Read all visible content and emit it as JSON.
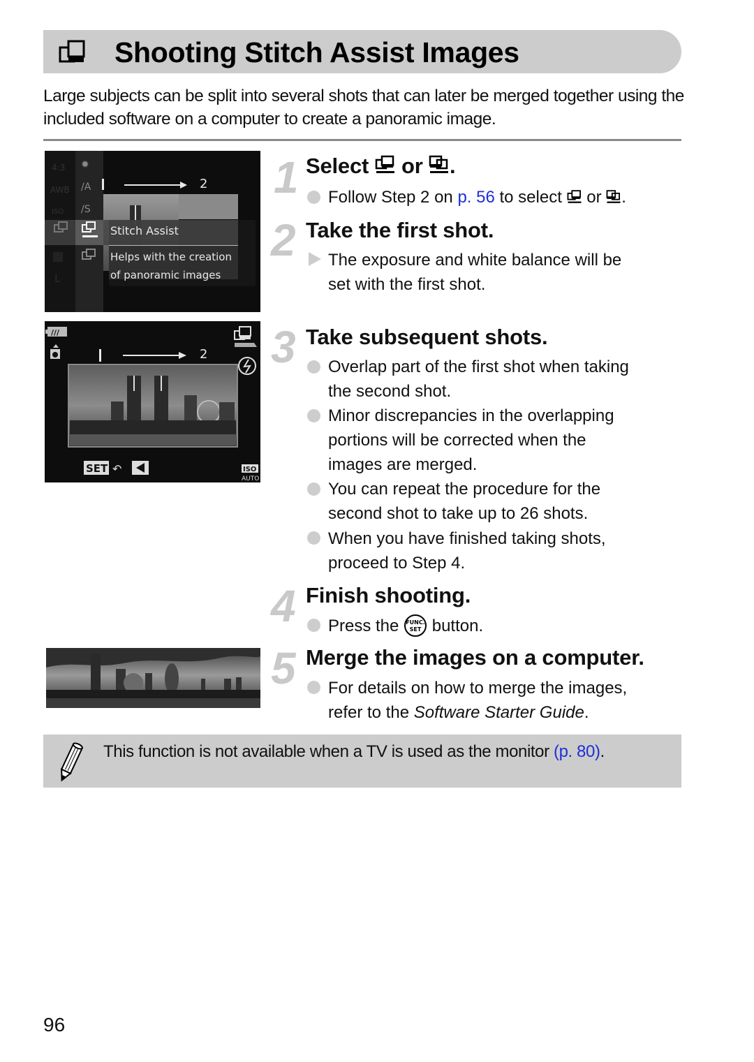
{
  "title": {
    "icon": "stitch-assist-icon",
    "text": "Shooting Stitch Assist Images"
  },
  "intro": "Large subjects can be split into several shots that can later be merged together using the included software on a computer to create a panoramic image.",
  "screen1": {
    "counter_from": "1",
    "counter_to": "2",
    "menu_item_title": "Stitch Assist",
    "menu_item_desc_line1": "Helps with the creation",
    "menu_item_desc_line2": "of panoramic images",
    "left_column_labels": [
      "4:3",
      "AWB",
      "ISO AUTO"
    ]
  },
  "screen2": {
    "counter_from": "1",
    "counter_to": "2",
    "set_label": "SET",
    "iso_top": "ISO",
    "iso_bottom": "AUTO"
  },
  "steps": [
    {
      "number": "1",
      "title_prefix": "Select",
      "title_mid": "or",
      "title_suffix": ".",
      "bullets": [
        {
          "type": "dot",
          "parts": {
            "a": "Follow Step 2 on ",
            "link": "p. 56",
            "b": " to select ",
            "c": " or ",
            "d": "."
          }
        }
      ]
    },
    {
      "number": "2",
      "title": "Take the first shot.",
      "bullets": [
        {
          "type": "result",
          "line1": "The exposure and white balance will be",
          "line2": "set with the first shot."
        }
      ]
    },
    {
      "number": "3",
      "title": "Take subsequent shots.",
      "bullets": [
        {
          "type": "dot",
          "line1": "Overlap part of the first shot when taking",
          "line2": "the second shot."
        },
        {
          "type": "dot",
          "line1": "Minor discrepancies in the overlapping",
          "line2": "portions will be corrected when the",
          "line3": "images are merged."
        },
        {
          "type": "dot",
          "line1": "You can repeat the procedure for the",
          "line2": "second shot to take up to 26 shots."
        },
        {
          "type": "dot",
          "line1": "When you have finished taking shots,",
          "line2": "proceed to Step 4."
        }
      ]
    },
    {
      "number": "4",
      "title": "Finish shooting.",
      "bullets": [
        {
          "type": "dot",
          "a": "Press the ",
          "button_top": "FUNC.",
          "button_bottom": "SET",
          "b": " button."
        }
      ]
    },
    {
      "number": "5",
      "title": "Merge the images on a computer.",
      "bullets": [
        {
          "type": "dot",
          "line1": "For details on how to merge the images,",
          "line2_a": "refer to the ",
          "line2_italic": "Software Starter Guide",
          "line2_b": "."
        }
      ]
    }
  ],
  "note": {
    "icon": "pencil-icon",
    "text": "This function is not available when a TV is used as the monitor ",
    "link": "(p. 80)",
    "end": "."
  },
  "page_number": "96",
  "colors": {
    "link": "#1f2fd6",
    "band": "#cccccc",
    "step_number": "#c9c9c9"
  }
}
